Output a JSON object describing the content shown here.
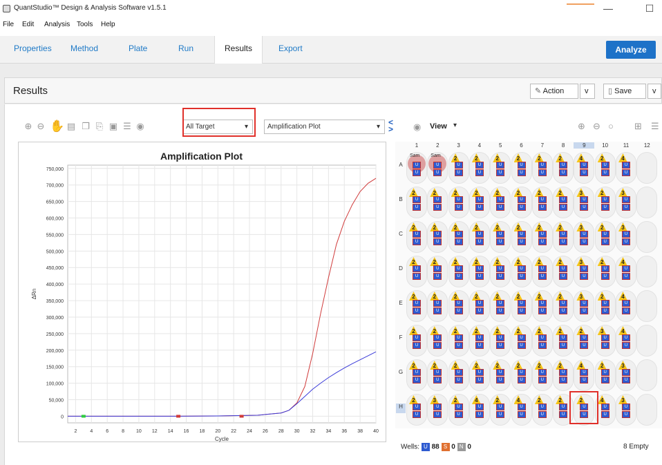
{
  "window": {
    "title": "QuantStudio™ Design & Analysis Software v1.5.1",
    "minimize": "—",
    "maximize": "☐"
  },
  "menu": [
    "File",
    "Edit",
    "Analysis",
    "Tools",
    "Help"
  ],
  "tabs": [
    "Properties",
    "Method",
    "Plate",
    "Run",
    "Results",
    "Export"
  ],
  "active_tab": "Results",
  "analyze_label": "Analyze",
  "results": {
    "title": "Results",
    "action_label": "Action",
    "save_label": "Save",
    "caret": "v"
  },
  "toolbar": {
    "target_select": "All Target",
    "plot_select": "Amplification Plot",
    "view_label": "View"
  },
  "chart_data": {
    "type": "line",
    "title": "Amplification Plot",
    "xlabel": "Cycle",
    "ylabel": "ΔRn",
    "xlim": [
      1,
      40
    ],
    "ylim": [
      -20000,
      760000
    ],
    "x_ticks": [
      2,
      4,
      6,
      8,
      10,
      12,
      14,
      16,
      18,
      20,
      22,
      24,
      26,
      28,
      30,
      32,
      34,
      36,
      38,
      40
    ],
    "y_ticks": [
      0,
      50000,
      100000,
      150000,
      200000,
      250000,
      300000,
      350000,
      400000,
      450000,
      500000,
      550000,
      600000,
      650000,
      700000,
      750000
    ],
    "y_tick_labels": [
      "0",
      "50,000",
      "100,000",
      "150,000",
      "200,000",
      "250,000",
      "300,000",
      "350,000",
      "400,000",
      "450,000",
      "500,000",
      "550,000",
      "600,000",
      "650,000",
      "700,000",
      "750,000"
    ],
    "grid": true,
    "series": [
      {
        "color": "#d03a3a",
        "x": [
          1,
          5,
          10,
          15,
          20,
          25,
          28,
          29,
          30,
          31,
          32,
          33,
          34,
          35,
          36,
          37,
          38,
          39,
          40
        ],
        "y": [
          0,
          0,
          0,
          0,
          1000,
          3000,
          10000,
          18000,
          40000,
          90000,
          190000,
          310000,
          420000,
          520000,
          590000,
          640000,
          680000,
          705000,
          720000
        ]
      },
      {
        "color": "#3a3ad8",
        "x": [
          1,
          5,
          10,
          15,
          20,
          25,
          28,
          29,
          30,
          31,
          32,
          33,
          34,
          35,
          36,
          37,
          38,
          39,
          40
        ],
        "y": [
          0,
          0,
          0,
          0,
          1000,
          3000,
          10000,
          18000,
          38000,
          60000,
          82000,
          100000,
          117000,
          132000,
          146000,
          159000,
          171000,
          183000,
          195000
        ]
      }
    ],
    "markers": [
      {
        "x": 3,
        "color": "#2ecc40"
      },
      {
        "x": 15,
        "color": "#d03a3a"
      },
      {
        "x": 23,
        "color": "#d03a3a"
      }
    ]
  },
  "plate": {
    "columns": [
      "1",
      "2",
      "3",
      "4",
      "5",
      "6",
      "7",
      "8",
      "9",
      "10",
      "11",
      "12"
    ],
    "selected_column": "9",
    "rows": [
      "A",
      "B",
      "C",
      "D",
      "E",
      "F",
      "G",
      "H"
    ],
    "selected_row": "H",
    "sample_label": "Sam",
    "unknown_label": "U",
    "well_numbers": [
      [
        "",
        "",
        "2",
        "2",
        "2",
        "2",
        "2",
        "2",
        "4",
        "2",
        "4",
        ""
      ],
      [
        "2",
        "2",
        "2",
        "2",
        "2",
        "2",
        "2",
        "2",
        "3",
        "2",
        "3",
        ""
      ],
      [
        "2",
        "2",
        "2",
        "2",
        "2",
        "2",
        "2",
        "2",
        "3",
        "2",
        "3",
        ""
      ],
      [
        "2",
        "2",
        "2",
        "2",
        "2",
        "2",
        "2",
        "2",
        "3",
        "2",
        "4",
        ""
      ],
      [
        "2",
        "2",
        "2",
        "2",
        "2",
        "2",
        "2",
        "2",
        "3",
        "2",
        "4",
        ""
      ],
      [
        "2",
        "2",
        "2",
        "2",
        "2",
        "2",
        "2",
        "2",
        "2",
        "3",
        "4",
        ""
      ],
      [
        "2",
        "2",
        "2",
        "2",
        "2",
        "2",
        "2",
        "2",
        "4",
        "2",
        "3",
        ""
      ],
      [
        "2",
        "3",
        "2",
        "4",
        "2",
        "4",
        "2",
        "2",
        "2",
        "4",
        "3",
        ""
      ]
    ]
  },
  "legend": {
    "prefix": "Wells:",
    "u_icon": "U",
    "u_count": "88",
    "s_icon": "S",
    "s_count": "0",
    "n_icon": "N",
    "n_count": "0",
    "empty": "8 Empty",
    "u_color": "#2e5bd0",
    "s_color": "#e07030",
    "n_color": "#999999"
  },
  "splitter": {
    "left": "<",
    "right": ">"
  }
}
